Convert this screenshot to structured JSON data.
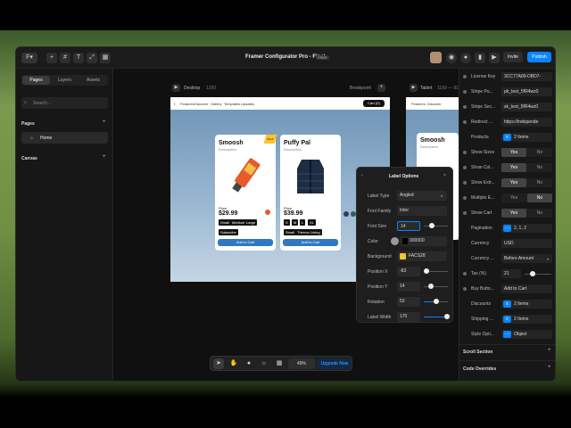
{
  "app": {
    "title": "Framer Configurator Pro - Final",
    "badge": "FREE",
    "invite": "Invite",
    "publish": "Publish"
  },
  "left": {
    "tabs": [
      "Pages",
      "Layers",
      "Assets"
    ],
    "search": "Search...",
    "pages_label": "Pages",
    "home": "Home",
    "canvas_label": "Canvas"
  },
  "canvas": {
    "desktop": "Desktop",
    "desktop_w": "1200",
    "breakpoint": "Breakpoint",
    "tablet": "Tablet",
    "tablet_w": "1199 — 81",
    "nav": [
      "Features",
      "Discover",
      "Gallery",
      "Templates",
      "Updates"
    ],
    "cart": "Cart (0)",
    "cards": [
      {
        "name": "Smoosh",
        "desc": "Description",
        "price_label": "Price",
        "price": "$29.99",
        "chips": [
          "Small",
          "Medium",
          "Large"
        ],
        "extra": [
          "Subscribe"
        ],
        "add": "Add to Cart"
      },
      {
        "name": "Puffy Pal",
        "desc": "Description",
        "price_label": "Price",
        "price": "$39.99",
        "chips": [
          "S",
          "M",
          "L",
          "XL"
        ],
        "extra": [
          "Small",
          "Thermo Lining"
        ],
        "add": "Add to Cart"
      }
    ],
    "tablet_card": "Smoosh",
    "tablet_desc": "Description",
    "ribbon": "SALE"
  },
  "popover": {
    "title": "Label Options",
    "rows": [
      {
        "label": "Label Type",
        "value": "Angled"
      },
      {
        "label": "Font Family",
        "value": "Inter"
      },
      {
        "label": "Font Size",
        "value": "14"
      },
      {
        "label": "Color",
        "value": "000000"
      },
      {
        "label": "Background",
        "value": "FACS28"
      },
      {
        "label": "Position X",
        "value": "-83"
      },
      {
        "label": "Position Y",
        "value": "14"
      },
      {
        "label": "Rotation",
        "value": "53"
      },
      {
        "label": "Label Width",
        "value": "170"
      }
    ]
  },
  "toolbar": {
    "zoom": "49%",
    "upgrade": "Upgrade Now"
  },
  "props": [
    {
      "label": "License Key",
      "value": "3CC77A09-DBD7-"
    },
    {
      "label": "Stripe Pu...",
      "value": "pk_test_5fR4wz0"
    },
    {
      "label": "Stripe Sec...",
      "value": "sk_test_5fR4wz0"
    },
    {
      "label": "Redirect ...",
      "value": "https://independe"
    },
    {
      "label": "Products",
      "value": "2 Items"
    },
    {
      "label": "Show Sizes",
      "yes": "Yes",
      "no": "No",
      "on": "yes"
    },
    {
      "label": "Show Col...",
      "yes": "Yes",
      "no": "No",
      "on": "yes"
    },
    {
      "label": "Show Extr...",
      "yes": "Yes",
      "no": "No",
      "on": "yes"
    },
    {
      "label": "Multiple E...",
      "yes": "Yes",
      "no": "No",
      "on": "no"
    },
    {
      "label": "Show Cart",
      "yes": "Yes",
      "no": "No",
      "on": "yes"
    },
    {
      "label": "Pagination",
      "value": "2, 1, 2"
    },
    {
      "label": "Currency",
      "value": "USD"
    },
    {
      "label": "Currency ...",
      "value": "Before Amount"
    },
    {
      "label": "Tax (%)",
      "value": "21"
    },
    {
      "label": "Buy Butto...",
      "value": "Add to Cart"
    },
    {
      "label": "Discounts",
      "value": "2 Items"
    },
    {
      "label": "Shipping ...",
      "value": "2 Items"
    },
    {
      "label": "Style Opti...",
      "value": "Object"
    }
  ],
  "sections": {
    "scroll": "Scroll Section",
    "overrides": "Code Overrides"
  },
  "colors": {
    "accent": "#0a84ff",
    "label_bg": "#FAC528",
    "upgrade": "#0a84ff"
  }
}
